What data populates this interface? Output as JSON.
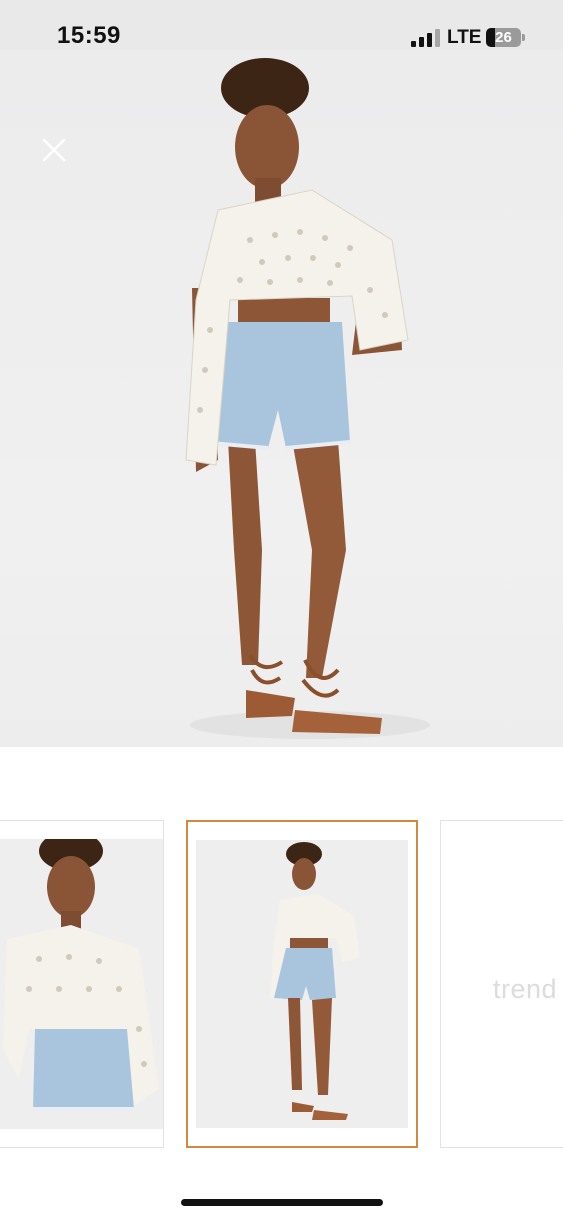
{
  "status_bar": {
    "time": "15:59",
    "network": "LTE",
    "battery_level": "26",
    "battery_fraction": 0.26,
    "signal_bars_active": 3,
    "signal_bars_total": 4
  },
  "viewer": {
    "close_icon": "close-icon",
    "main_image": "model-full-body-photo",
    "accent_color": "#d18a3d"
  },
  "thumbnails": [
    {
      "name": "model-close-up-photo",
      "selected": false
    },
    {
      "name": "model-full-body-photo",
      "selected": true
    },
    {
      "name": "placeholder",
      "selected": false,
      "watermark": "trend"
    }
  ]
}
